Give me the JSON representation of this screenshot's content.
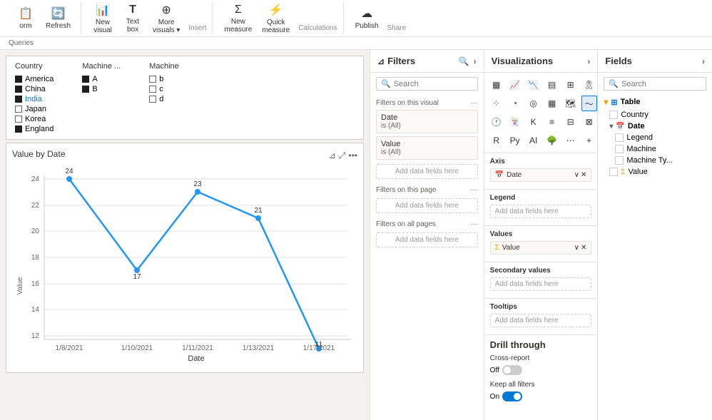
{
  "toolbar": {
    "groups": [
      {
        "label": "",
        "buttons": [
          {
            "id": "form-btn",
            "icon": "📋",
            "label": "orm"
          },
          {
            "id": "refresh-btn",
            "icon": "🔄",
            "label": "Refresh"
          }
        ]
      },
      {
        "label": "Insert",
        "buttons": [
          {
            "id": "new-visual-btn",
            "icon": "📊",
            "label": "New visual"
          },
          {
            "id": "text-box-btn",
            "icon": "T",
            "label": "Text box"
          },
          {
            "id": "more-visuals-btn",
            "icon": "⊕",
            "label": "More visuals"
          }
        ]
      },
      {
        "label": "Calculations",
        "buttons": [
          {
            "id": "new-measure-btn",
            "icon": "∑",
            "label": "New measure"
          },
          {
            "id": "quick-measure-btn",
            "icon": "⚡",
            "label": "Quick measure"
          }
        ]
      },
      {
        "label": "Share",
        "buttons": [
          {
            "id": "publish-btn",
            "icon": "☁",
            "label": "Publish"
          }
        ]
      }
    ]
  },
  "ribbon_labels": [
    "Queries",
    "Insert",
    "Calculations",
    "Share"
  ],
  "filters": {
    "title": "Filters",
    "search_placeholder": "Search",
    "on_this_visual_label": "Filters on this visual",
    "on_this_page_label": "Filters on this page",
    "on_all_pages_label": "Filters on all pages",
    "cards": [
      {
        "title": "Date",
        "value": "is (All)"
      },
      {
        "title": "Value",
        "value": "is (All)"
      }
    ],
    "add_data_label": "Add data fields here"
  },
  "visualizations": {
    "title": "Visualizations",
    "axis_label": "Axis",
    "axis_field": "Date",
    "legend_label": "Legend",
    "legend_placeholder": "Add data fields here",
    "values_label": "Values",
    "values_field": "Value",
    "secondary_values_label": "Secondary values",
    "secondary_values_placeholder": "Add data fields here",
    "tooltips_label": "Tooltips",
    "tooltips_placeholder": "Add data fields here",
    "drill_through_title": "Drill through",
    "cross_report_label": "Cross-report",
    "cross_report_value": "Off",
    "keep_all_filters_label": "Keep all filters",
    "keep_all_filters_value": "On"
  },
  "fields": {
    "title": "Fields",
    "search_placeholder": "Search",
    "table_name": "Table",
    "items": [
      {
        "name": "Country",
        "type": "text",
        "checked": false
      },
      {
        "name": "Date",
        "type": "date",
        "checked": false,
        "expanded": true
      },
      {
        "name": "Legend",
        "type": "text",
        "checked": false
      },
      {
        "name": "Machine",
        "type": "text",
        "checked": false
      },
      {
        "name": "Machine Ty...",
        "type": "text",
        "checked": false
      },
      {
        "name": "Value",
        "type": "sigma",
        "checked": false
      }
    ]
  },
  "chart": {
    "title": "Value by Date",
    "y_label": "Value",
    "x_label": "Date",
    "data_points": [
      {
        "date": "1/8/2021",
        "value": 24
      },
      {
        "date": "1/10/2021",
        "value": 17
      },
      {
        "date": "1/11/2021",
        "value": 23
      },
      {
        "date": "1/13/2021",
        "value": 21
      },
      {
        "date": "1/17/2021",
        "value": 11
      }
    ],
    "y_min": 12,
    "y_max": 24,
    "y_ticks": [
      12,
      14,
      16,
      18,
      20,
      22,
      24
    ]
  },
  "legend": {
    "groups": [
      {
        "title": "Country",
        "items": [
          {
            "label": "America",
            "color": "#1f1f1f",
            "filled": true
          },
          {
            "label": "China",
            "color": "#1f1f1f",
            "filled": true
          },
          {
            "label": "India",
            "color": "#1f1f1f",
            "filled": true
          },
          {
            "label": "Japan",
            "color": "#1f1f1f",
            "filled": false
          },
          {
            "label": "Korea",
            "color": "#1f1f1f",
            "filled": false
          },
          {
            "label": "England",
            "color": "#1f1f1f",
            "filled": true
          }
        ]
      },
      {
        "title": "Machine ...",
        "items": [
          {
            "label": "A",
            "color": "#1f1f1f",
            "filled": true
          },
          {
            "label": "B",
            "color": "#1f1f1f",
            "filled": true
          }
        ]
      },
      {
        "title": "Machine",
        "items": [
          {
            "label": "b",
            "color": "#1f1f1f",
            "filled": false
          },
          {
            "label": "c",
            "color": "#1f1f1f",
            "filled": false
          },
          {
            "label": "d",
            "color": "#1f1f1f",
            "filled": false
          }
        ]
      }
    ]
  }
}
